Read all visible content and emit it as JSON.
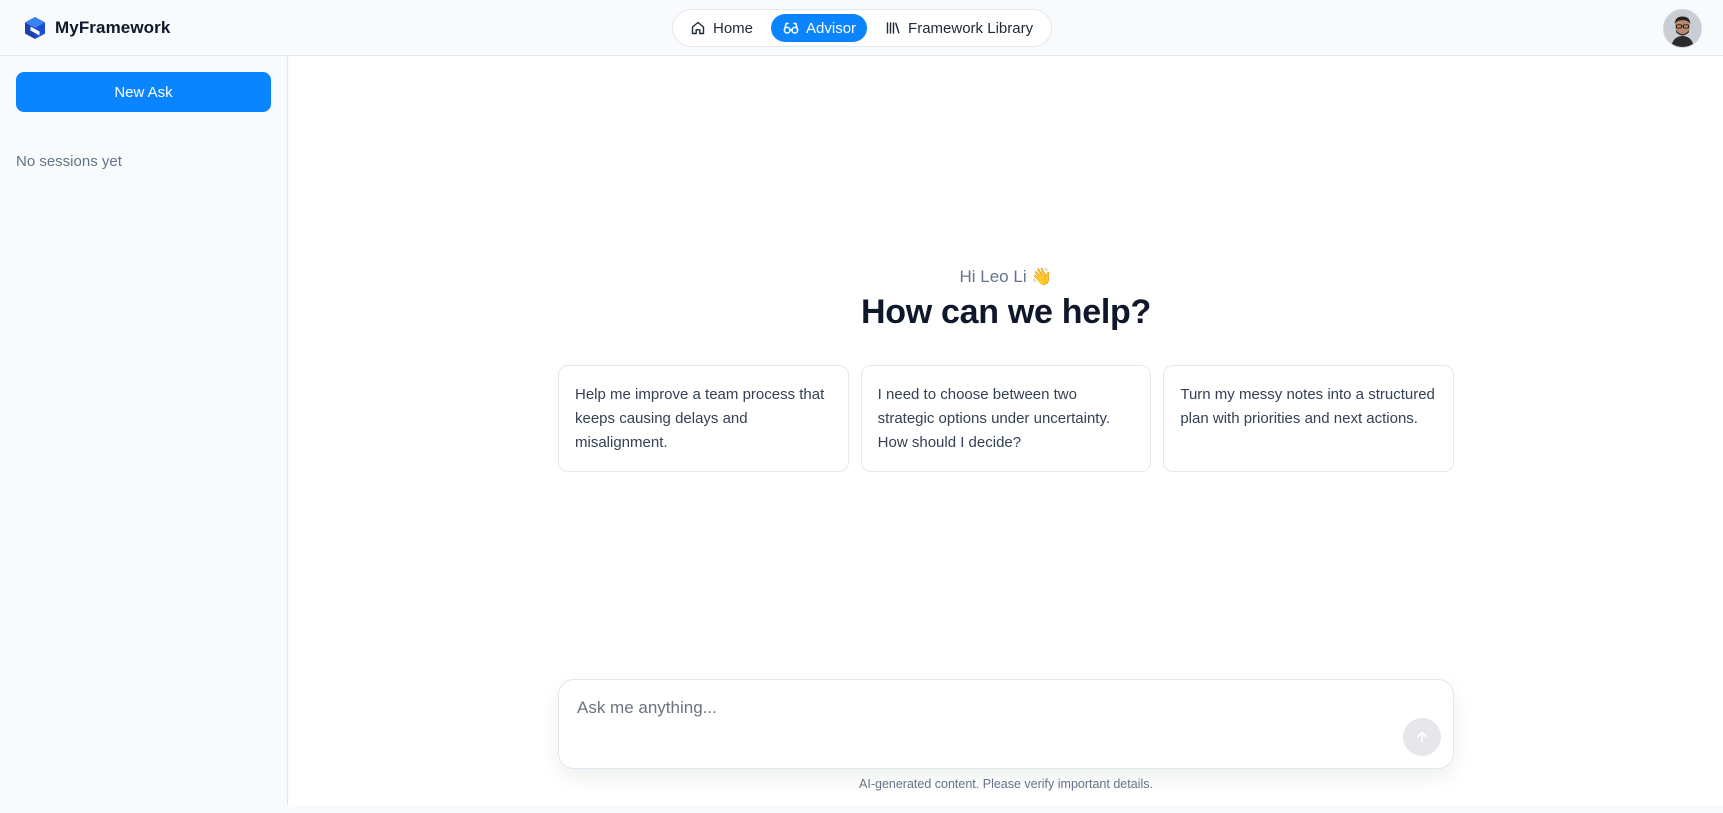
{
  "app": {
    "name": "MyFramework",
    "logo_icon": "cube-logo-icon",
    "accent_color": "#0a84ff"
  },
  "nav": {
    "items": [
      {
        "label": "Home",
        "icon": "home-icon",
        "active": false
      },
      {
        "label": "Advisor",
        "icon": "glasses-icon",
        "active": true
      },
      {
        "label": "Framework Library",
        "icon": "library-icon",
        "active": false
      }
    ]
  },
  "user": {
    "avatar_icon": "user-avatar"
  },
  "sidebar": {
    "new_ask_label": "New Ask",
    "empty_text": "No sessions yet"
  },
  "main": {
    "greeting": "Hi Leo Li 👋",
    "headline": "How can we help?",
    "suggestions": [
      "Help me improve a team process that keeps causing delays and misalignment.",
      "I need to choose between two strategic options under uncertainty. How should I decide?",
      "Turn my messy notes into a structured plan with priorities and next actions."
    ],
    "composer": {
      "placeholder": "Ask me anything...",
      "value": "",
      "send_icon": "arrow-up-icon"
    },
    "disclaimer": "AI-generated content. Please verify important details."
  }
}
